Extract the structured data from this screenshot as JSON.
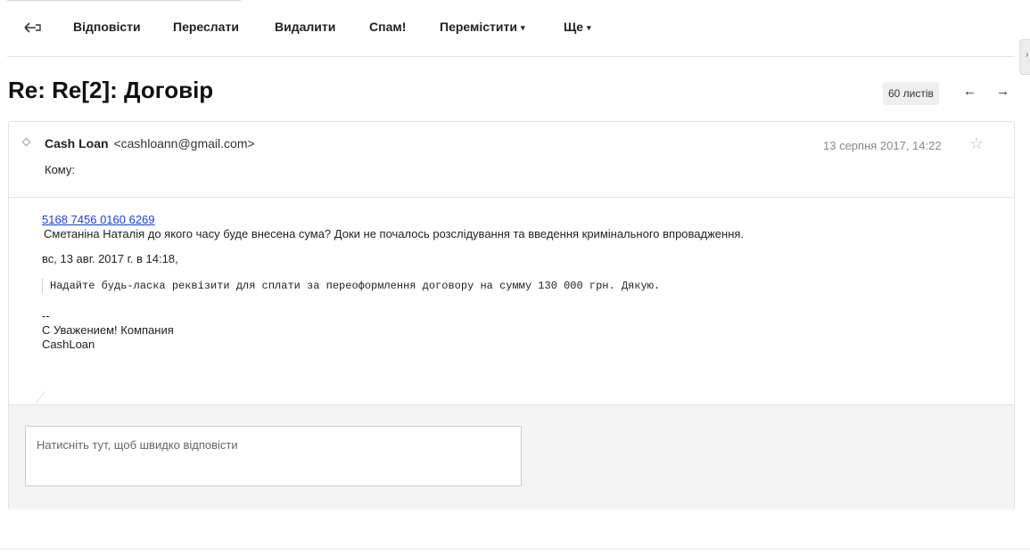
{
  "toolbar": {
    "back_icon": "back-arrow-icon",
    "reply": "Відповісти",
    "forward": "Переслати",
    "delete": "Видалити",
    "spam": "Спам!",
    "move": "Перемістити",
    "more": "Ще",
    "caret": "▾"
  },
  "subject": "Re: Re[2]: Договір",
  "thread": {
    "count_label": "60 листів",
    "prev_arrow": "←",
    "next_arrow": "→"
  },
  "message": {
    "sender_name": "Cash Loan",
    "sender_email": "<cashloann@gmail.com>",
    "to_label": "Кому:",
    "date": "13 серпня 2017, 14:22",
    "star": "☆",
    "body": {
      "link": "5168 7456 0160 6269",
      "para1": "Сметаніна Наталія до якого часу буде внесена сума? Доки не почалось розслідування та введення кримінального впровадження.",
      "quote_intro": "вс, 13 авг. 2017 г. в 14:18,",
      "quote": "Надайте будь-ласка реквізити для сплати за переоформлення договору на сумму 130 000 грн. Дякую.",
      "sig_dash": "--",
      "sig_line1": "С Уважением! Компания",
      "sig_line2": "CashLoan"
    }
  },
  "reply_placeholder": "Натисніть тут, щоб швидко відповісти",
  "side_tab_glyph": "›"
}
